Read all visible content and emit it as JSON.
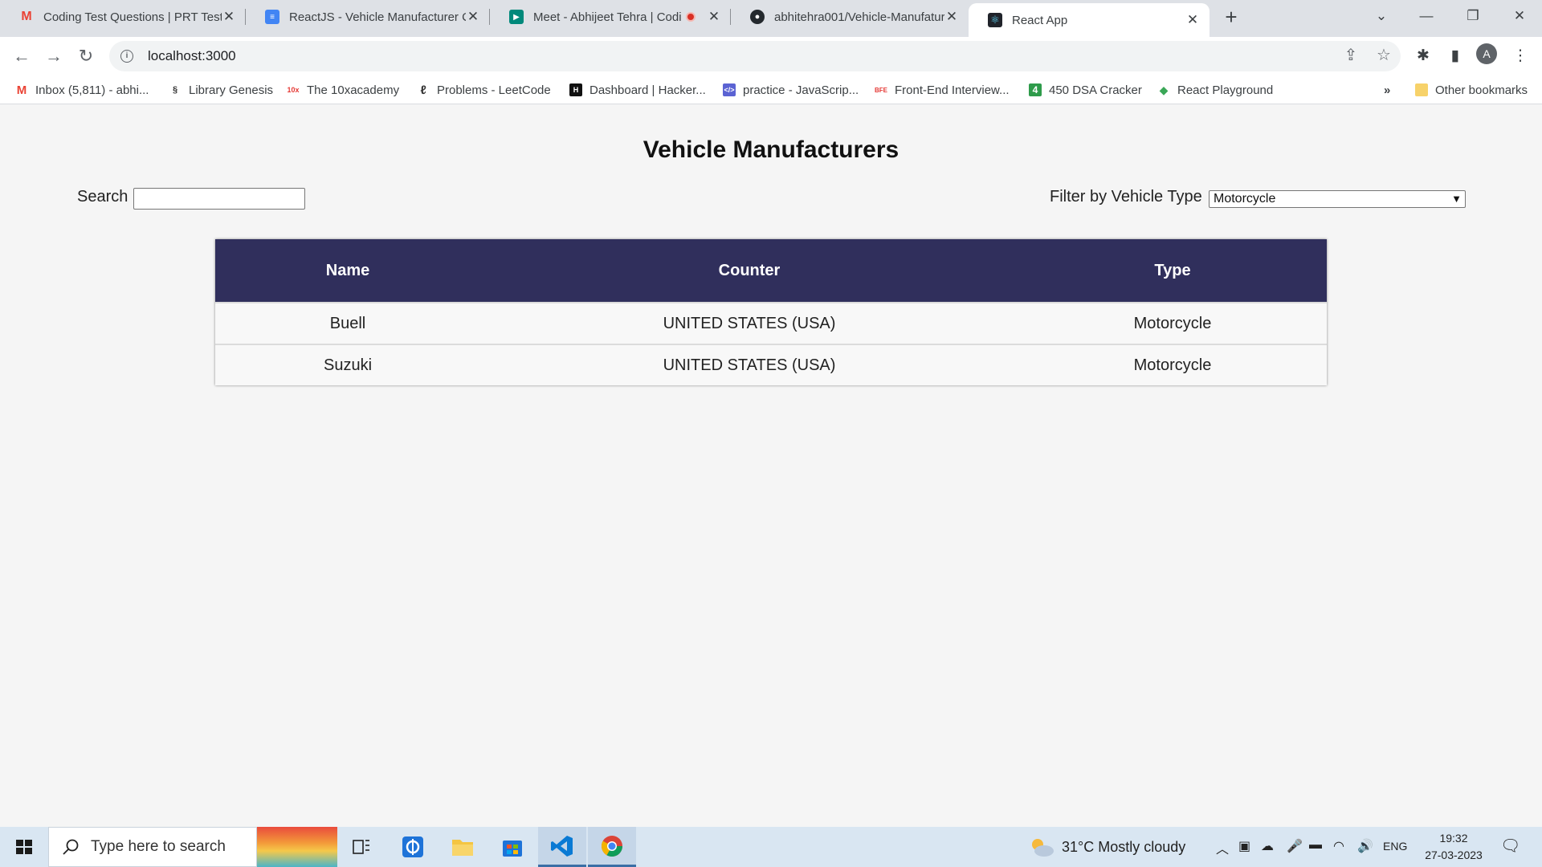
{
  "browser": {
    "tabs": [
      {
        "title": "Coding Test Questions | PRT Test",
        "favicon": "gmail-icon"
      },
      {
        "title": "ReactJS - Vehicle Manufacturer C",
        "favicon": "google-docs-icon"
      },
      {
        "title": "Meet - Abhijeet Tehra | Codi",
        "favicon": "google-meet-icon"
      },
      {
        "title": "abhitehra001/Vehicle-Manufatur",
        "favicon": "github-icon"
      },
      {
        "title": "React App",
        "favicon": "react-icon"
      }
    ],
    "address": "localhost:3000",
    "profile_initial": "A",
    "bookmarks": [
      {
        "label": "Inbox (5,811) - abhi...",
        "icon": "gmail-icon"
      },
      {
        "label": "Library Genesis",
        "icon": "libgen-icon"
      },
      {
        "label": "The 10xacademy",
        "icon": "tenx-icon"
      },
      {
        "label": "Problems - LeetCode",
        "icon": "leetcode-icon"
      },
      {
        "label": "Dashboard | Hacker...",
        "icon": "hackerrank-icon"
      },
      {
        "label": "practice - JavaScrip...",
        "icon": "code-icon"
      },
      {
        "label": "Front-End Interview...",
        "icon": "bfe-icon"
      },
      {
        "label": "450 DSA Cracker",
        "icon": "four-icon"
      },
      {
        "label": "React Playground",
        "icon": "codesandbox-icon"
      }
    ],
    "bookmarks_overflow": "»",
    "other_bookmarks": "Other bookmarks"
  },
  "page": {
    "title": "Vehicle Manufacturers",
    "search_label": "Search",
    "search_value": "",
    "filter_label": "Filter by Vehicle Type",
    "filter_value": "Motorcycle",
    "table": {
      "headers": [
        "Name",
        "Counter",
        "Type"
      ],
      "rows": [
        [
          "Buell",
          "UNITED STATES (USA)",
          "Motorcycle"
        ],
        [
          "Suzuki",
          "UNITED STATES (USA)",
          "Motorcycle"
        ]
      ]
    }
  },
  "taskbar": {
    "search_placeholder": "Type here to search",
    "weather": "31°C  Mostly cloudy",
    "language": "ENG",
    "time": "19:32",
    "date": "27-03-2023"
  }
}
